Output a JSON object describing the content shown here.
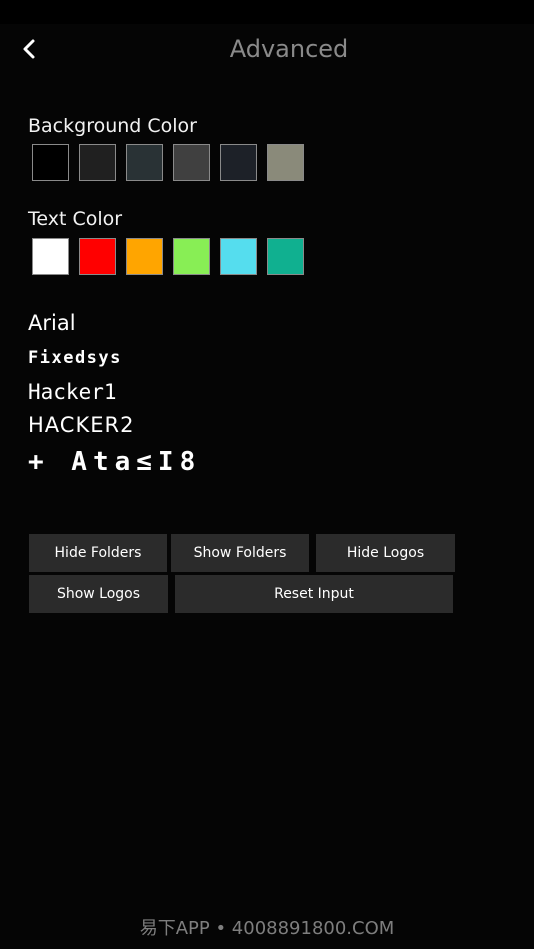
{
  "header": {
    "title": "Advanced",
    "back_icon": "chevron-left-icon"
  },
  "background_color": {
    "label": "Background Color",
    "swatches": [
      "#000000",
      "#202020",
      "#293235",
      "#404040",
      "#1d2128",
      "#8a8a7a"
    ]
  },
  "text_color": {
    "label": "Text Color",
    "swatches": [
      "#ffffff",
      "#ff0000",
      "#ffa500",
      "#88ee55",
      "#55ddee",
      "#10b090"
    ]
  },
  "fonts": {
    "arial": "Arial",
    "fixedsys": "Fixedsys",
    "hacker1": "Hacker1",
    "hacker2": "HACKER2",
    "alien": "+ Ata≤I8"
  },
  "buttons": {
    "hide_folders": "Hide Folders",
    "show_folders": "Show Folders",
    "hide_logos": "Hide Logos",
    "show_logos": "Show Logos",
    "reset_input": "Reset Input"
  },
  "footer": {
    "watermark": "易下APP • 4008891800.COM"
  }
}
